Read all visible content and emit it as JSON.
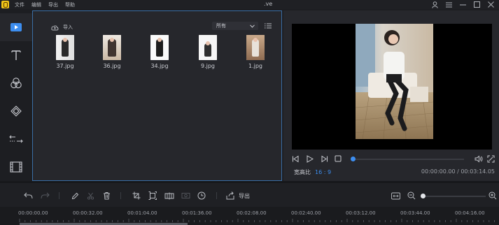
{
  "titlebar": {
    "menu": [
      "文件",
      "编辑",
      "导出",
      "帮助"
    ],
    "title": ".ve"
  },
  "rail": {
    "items": [
      "media-icon",
      "text-icon",
      "filters-icon",
      "overlay-icon",
      "transitions-icon",
      "elements-icon"
    ]
  },
  "library": {
    "import_label": "导入",
    "filter_value": "所有",
    "files": [
      {
        "name": "37.jpg"
      },
      {
        "name": "36.jpg"
      },
      {
        "name": "34.jpg"
      },
      {
        "name": "9.jpg"
      },
      {
        "name": "1.jpg"
      }
    ]
  },
  "preview": {
    "aspect_label": "宽高比",
    "aspect_value": "16 : 9",
    "timecode": "00:00:00.00 / 00:03:14.05",
    "progress": 0
  },
  "toolbar": {
    "export_label": "导出",
    "zoom_level": 0
  },
  "ruler": {
    "labels": [
      "00:00:00.00",
      "00:00:32.00",
      "00:01:04.00",
      "00:01:36.00",
      "00:02:08.00",
      "00:02:40.00",
      "00:03:12.00",
      "00:03:44.00",
      "00:04:16.00"
    ]
  },
  "colors": {
    "accent": "#3d8ef0",
    "panel": "#26272c",
    "background": "#1d1e22"
  }
}
